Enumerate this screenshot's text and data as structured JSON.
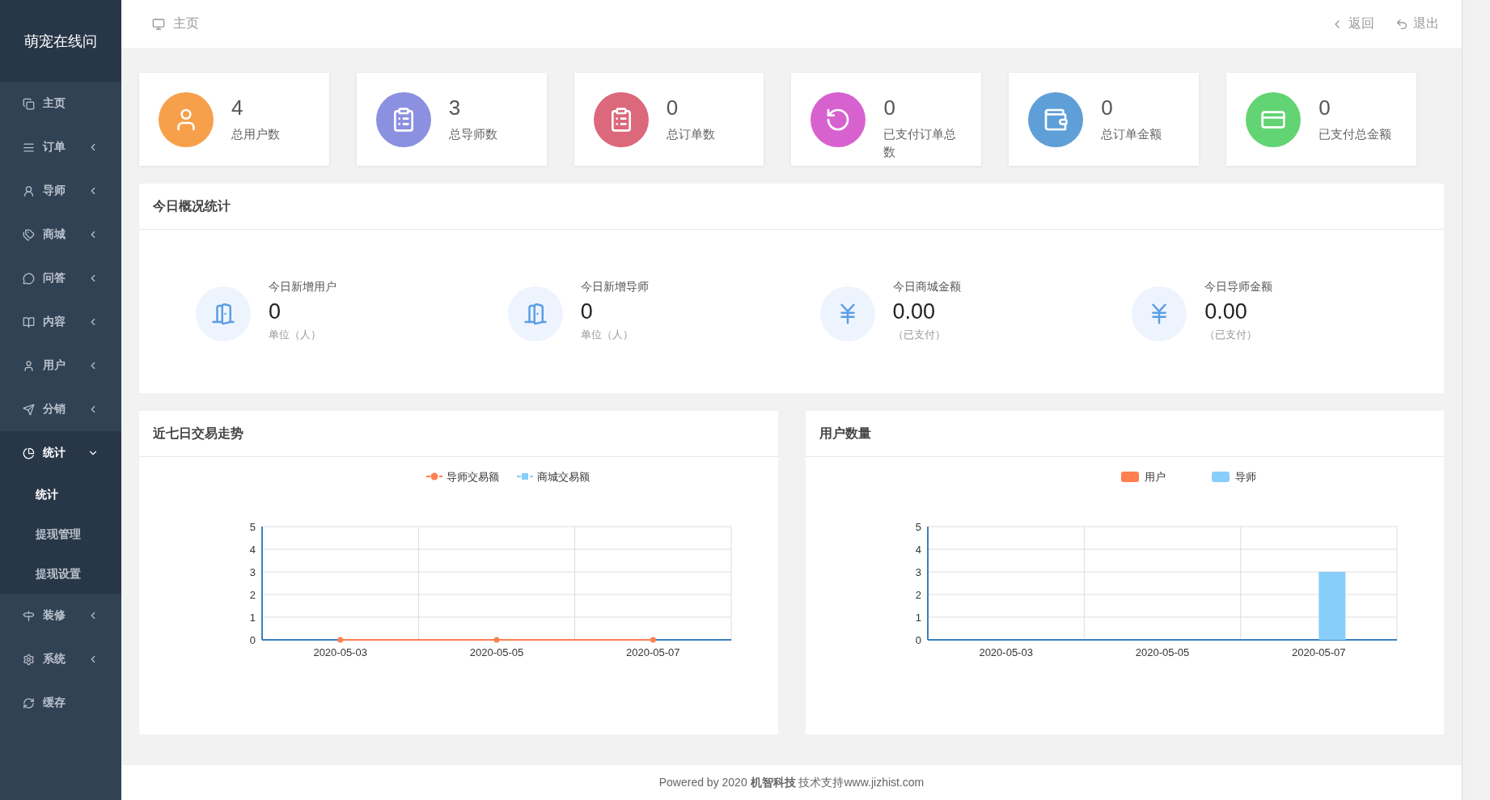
{
  "sidebar": {
    "brand": "萌宠在线问",
    "items": [
      {
        "label": "主页",
        "selected": false
      },
      {
        "label": "订单",
        "expanded": false,
        "selected": false
      },
      {
        "label": "导师",
        "expanded": false,
        "selected": false
      },
      {
        "label": "商城",
        "expanded": false,
        "selected": false
      },
      {
        "label": "问答",
        "expanded": false,
        "selected": false
      },
      {
        "label": "内容",
        "expanded": false,
        "selected": false
      },
      {
        "label": "用户",
        "expanded": false,
        "selected": false
      },
      {
        "label": "分销",
        "expanded": false,
        "selected": false
      },
      {
        "label": "统计",
        "expanded": true,
        "selected": true,
        "children": [
          {
            "label": "统计",
            "selected": true
          },
          {
            "label": "提现管理",
            "selected": false
          },
          {
            "label": "提现设置",
            "selected": false
          }
        ]
      },
      {
        "label": "装修",
        "expanded": false,
        "selected": false
      },
      {
        "label": "系统",
        "expanded": false,
        "selected": false
      },
      {
        "label": "缓存",
        "selected": false
      }
    ]
  },
  "topbar": {
    "breadcrumb": "主页",
    "actions": [
      {
        "label": "返回"
      },
      {
        "label": "退出"
      }
    ]
  },
  "summary_cards": [
    {
      "value": "4",
      "label": "总用户数",
      "color": "#f7a04b"
    },
    {
      "value": "3",
      "label": "总导师数",
      "color": "#8b90e0"
    },
    {
      "value": "0",
      "label": "总订单数",
      "color": "#dc687b"
    },
    {
      "value": "0",
      "label": "已支付订单总数",
      "color": "#d762cf"
    },
    {
      "value": "0",
      "label": "总订单金额",
      "color": "#5f9fd8"
    },
    {
      "value": "0",
      "label": "已支付总金额",
      "color": "#62d474"
    }
  ],
  "today": {
    "title": "今日概况统计",
    "items": [
      {
        "label": "今日新增用户",
        "value": "0",
        "unit": "单位（人）"
      },
      {
        "label": "今日新增导师",
        "value": "0",
        "unit": "单位（人）"
      },
      {
        "label": "今日商城金额",
        "value": "0.00",
        "unit": "（已支付）"
      },
      {
        "label": "今日导师金额",
        "value": "0.00",
        "unit": "（已支付）"
      }
    ]
  },
  "charts": [
    {
      "title": "近七日交易走势",
      "chart_data": {
        "type": "line",
        "categories": [
          "2020-05-03",
          "2020-05-05",
          "2020-05-07"
        ],
        "ylim": [
          0,
          5
        ],
        "yticks": [
          0,
          1,
          2,
          3,
          4,
          5
        ],
        "grid": true,
        "legend": "top",
        "series": [
          {
            "name": "导师交易额",
            "color": "#ff7f50",
            "marker": "circle",
            "values": [
              0,
              0,
              0
            ]
          },
          {
            "name": "商城交易额",
            "color": "#87cefa",
            "marker": "square",
            "values": [
              null,
              null,
              null
            ]
          }
        ]
      }
    },
    {
      "title": "用户数量",
      "chart_data": {
        "type": "bar",
        "categories": [
          "2020-05-03",
          "2020-05-05",
          "2020-05-07"
        ],
        "ylim": [
          0,
          5
        ],
        "yticks": [
          0,
          1,
          2,
          3,
          4,
          5
        ],
        "grid": true,
        "legend": "top",
        "series": [
          {
            "name": "用户",
            "color": "#ff7f50",
            "values": [
              null,
              null,
              null
            ]
          },
          {
            "name": "导师",
            "color": "#87cefa",
            "values": [
              null,
              null,
              3
            ]
          }
        ]
      }
    }
  ],
  "footer": {
    "text": "Powered by 2020 **机智科技** 技术支持www.jizhist.com"
  }
}
